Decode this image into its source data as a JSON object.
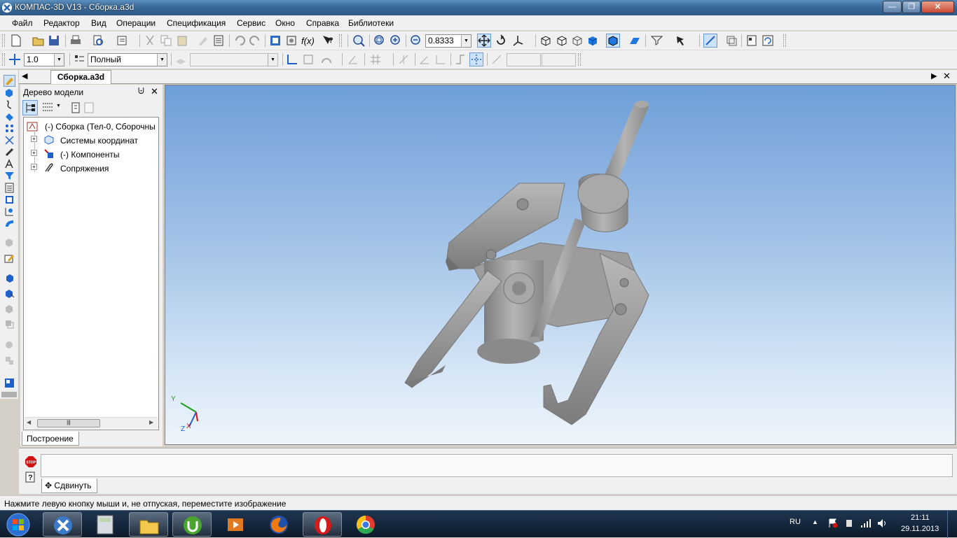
{
  "window": {
    "title": "КОМПАС-3D V13 - Сборка.a3d"
  },
  "menu": [
    "Файл",
    "Редактор",
    "Вид",
    "Операции",
    "Спецификация",
    "Сервис",
    "Окно",
    "Справка",
    "Библиотеки"
  ],
  "toolbar": {
    "zoom_value": "0.8333",
    "step_value": "1.0",
    "display_mode": "Полный"
  },
  "document_tab": "Сборка.a3d",
  "tree_panel": {
    "title": "Дерево модели",
    "tab": "Построение",
    "nodes": [
      {
        "label": "(-) Сборка (Тел-0, Сборочны"
      },
      {
        "label": "Системы координат"
      },
      {
        "label": "(-) Компоненты"
      },
      {
        "label": "Сопряжения"
      }
    ]
  },
  "axes": {
    "x": "X",
    "y": "Y",
    "z": "Z"
  },
  "command": {
    "move_label": "Сдвинуть"
  },
  "status_text": "Нажмите левую кнопку мыши и, не отпуская, переместите изображение",
  "taskbar": {
    "lang": "RU",
    "time": "21:11",
    "date": "29.11.2013"
  },
  "colors": {
    "viewport_top": "#6e9ed8",
    "viewport_bottom": "#eef5fb",
    "model_gray": "#9a9a9a",
    "titlebar": "#3b6a98"
  },
  "icons": [
    "kompas-app-icon",
    "new-file-icon",
    "open-icon",
    "save-icon",
    "print-icon",
    "zoom-icon",
    "pan-icon",
    "rotate-icon",
    "shaded-view-icon",
    "help-icon",
    "stop-icon",
    "start-icon",
    "firefox-icon",
    "chrome-icon",
    "opera-icon",
    "utorrent-icon",
    "calculator-icon",
    "explorer-icon"
  ]
}
